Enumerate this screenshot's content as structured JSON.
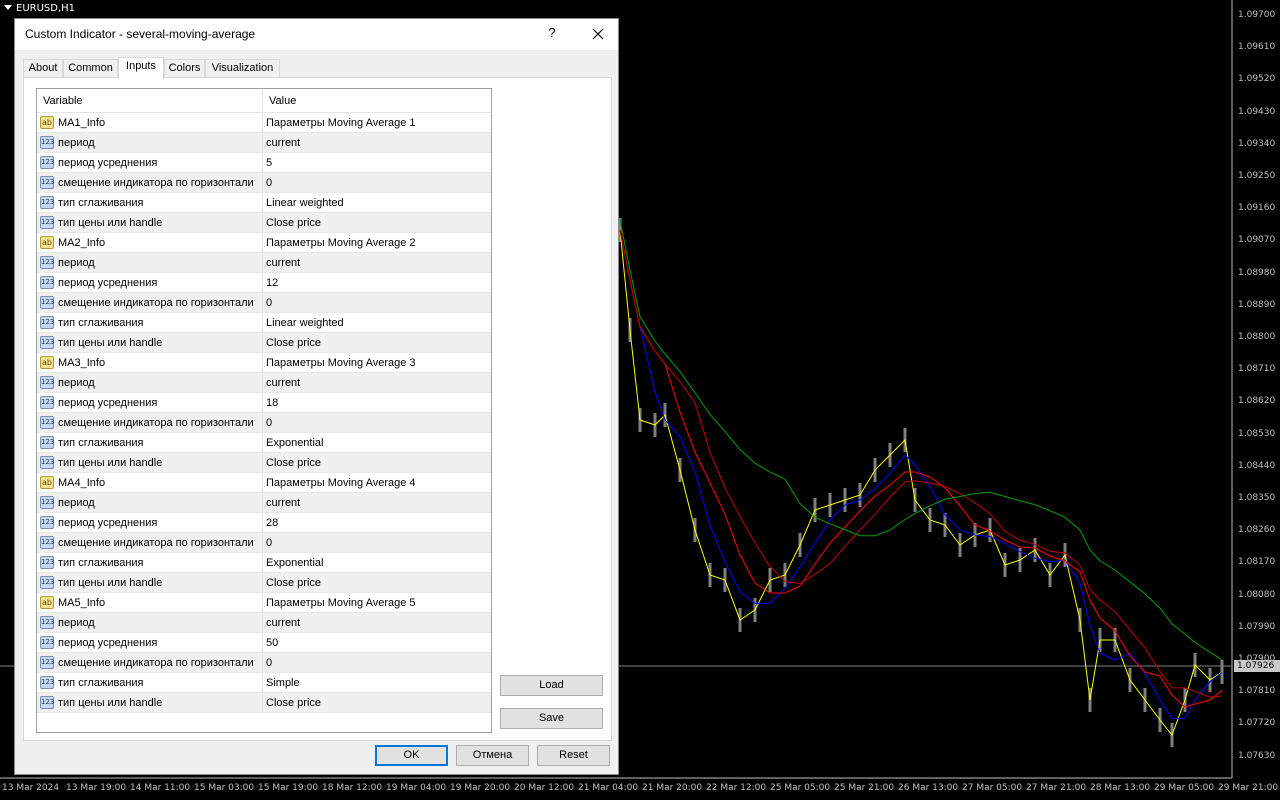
{
  "chart": {
    "symbol": "EURUSD,H1",
    "current_price": "1.07926",
    "price_ticks": [
      "1.09700",
      "1.09610",
      "1.09520",
      "1.09430",
      "1.09340",
      "1.09250",
      "1.09160",
      "1.09070",
      "1.08980",
      "1.08890",
      "1.08800",
      "1.08710",
      "1.08620",
      "1.08530",
      "1.08440",
      "1.08350",
      "1.08260",
      "1.08170",
      "1.08080",
      "1.07990",
      "1.07900",
      "1.07810",
      "1.07720",
      "1.07630"
    ],
    "time_ticks": [
      "13 Mar 2024",
      "13 Mar 19:00",
      "14 Mar 11:00",
      "15 Mar 03:00",
      "15 Mar 19:00",
      "18 Mar 12:00",
      "19 Mar 04:00",
      "19 Mar 20:00",
      "20 Mar 12:00",
      "21 Mar 04:00",
      "21 Mar 20:00",
      "22 Mar 12:00",
      "25 Mar 05:00",
      "25 Mar 21:00",
      "26 Mar 13:00",
      "27 Mar 05:00",
      "27 Mar 21:00",
      "28 Mar 13:00",
      "29 Mar 05:00",
      "29 Mar 21:00"
    ],
    "colors": {
      "ma_yellow": "#ffff00",
      "ma_blue": "#0000ff",
      "ma_red": "#ff0000",
      "ma_darkred": "#c00000",
      "ma_green": "#00a000",
      "candles": "#808080"
    }
  },
  "dialog": {
    "title": "Custom Indicator - several-moving-average",
    "help": "?",
    "tabs": [
      "About",
      "Common",
      "Inputs",
      "Colors",
      "Visualization"
    ],
    "active_tab": "Inputs",
    "columns": {
      "variable": "Variable",
      "value": "Value"
    },
    "rows": [
      {
        "type": "ab",
        "variable": "MA1_Info",
        "value": "Параметры Moving Average 1"
      },
      {
        "type": "123",
        "variable": "период",
        "value": "current"
      },
      {
        "type": "123",
        "variable": "период усреднения",
        "value": "5"
      },
      {
        "type": "123",
        "variable": "смещение индикатора по горизонтали",
        "value": "0"
      },
      {
        "type": "123",
        "variable": "тип сглаживания",
        "value": "Linear weighted"
      },
      {
        "type": "123",
        "variable": "тип цены или handle",
        "value": "Close price"
      },
      {
        "type": "ab",
        "variable": "MA2_Info",
        "value": "Параметры Moving Average 2"
      },
      {
        "type": "123",
        "variable": "период",
        "value": "current"
      },
      {
        "type": "123",
        "variable": "период усреднения",
        "value": "12"
      },
      {
        "type": "123",
        "variable": "смещение индикатора по горизонтали",
        "value": "0"
      },
      {
        "type": "123",
        "variable": "тип сглаживания",
        "value": "Linear weighted"
      },
      {
        "type": "123",
        "variable": "тип цены или handle",
        "value": "Close price"
      },
      {
        "type": "ab",
        "variable": "MA3_Info",
        "value": "Параметры Moving Average 3"
      },
      {
        "type": "123",
        "variable": "период",
        "value": "current"
      },
      {
        "type": "123",
        "variable": "период усреднения",
        "value": "18"
      },
      {
        "type": "123",
        "variable": "смещение индикатора по горизонтали",
        "value": "0"
      },
      {
        "type": "123",
        "variable": "тип сглаживания",
        "value": "Exponential"
      },
      {
        "type": "123",
        "variable": "тип цены или handle",
        "value": "Close price"
      },
      {
        "type": "ab",
        "variable": "MA4_Info",
        "value": "Параметры Moving Average 4"
      },
      {
        "type": "123",
        "variable": "период",
        "value": "current"
      },
      {
        "type": "123",
        "variable": "период усреднения",
        "value": "28"
      },
      {
        "type": "123",
        "variable": "смещение индикатора по горизонтали",
        "value": "0"
      },
      {
        "type": "123",
        "variable": "тип сглаживания",
        "value": "Exponential"
      },
      {
        "type": "123",
        "variable": "тип цены или handle",
        "value": "Close price"
      },
      {
        "type": "ab",
        "variable": "MA5_Info",
        "value": "Параметры Moving Average 5"
      },
      {
        "type": "123",
        "variable": "период",
        "value": "current"
      },
      {
        "type": "123",
        "variable": "период усреднения",
        "value": "50"
      },
      {
        "type": "123",
        "variable": "смещение индикатора по горизонтали",
        "value": "0"
      },
      {
        "type": "123",
        "variable": "тип сглаживания",
        "value": "Simple"
      },
      {
        "type": "123",
        "variable": "тип цены или handle",
        "value": "Close price"
      }
    ],
    "buttons": {
      "load": "Load",
      "save": "Save",
      "ok": "OK",
      "cancel": "Отмена",
      "reset": "Reset"
    }
  }
}
